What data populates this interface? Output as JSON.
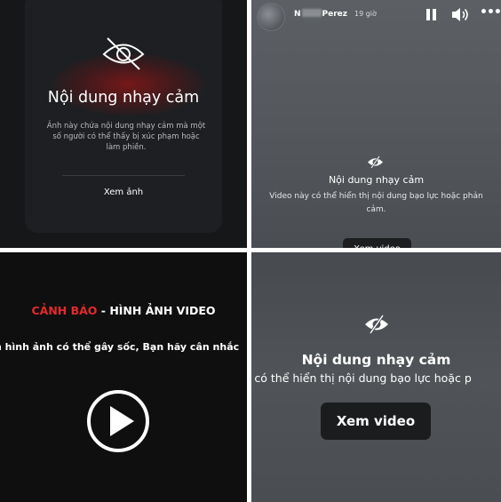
{
  "panel1": {
    "title": "Nội dung nhạy cảm",
    "description": "Ảnh này chứa nội dung nhạy cảm mà một số người có thể thấy bị xúc phạm hoặc làm phiền.",
    "button_label": "Xem ảnh",
    "icon": "eye-slash-icon",
    "glow_color": "#c41414"
  },
  "panel2": {
    "user_first": "N",
    "user_last": "Perez",
    "timestamp": "19 giờ",
    "title": "Nội dung nhạy cảm",
    "description": "Video này có thể hiển thị nội dung bạo lực hoặc phản cảm.",
    "button_label": "Xem video",
    "icons": [
      "avatar",
      "pause-icon",
      "volume-icon",
      "more-icon",
      "eye-slash-icon"
    ]
  },
  "panel3": {
    "warning_red": "CẢNH BÁO",
    "warning_white": " - HÌNH ẢNH VIDEO",
    "subtitle": "n hình ảnh có thể gây sốc, Bạn hãy cân nhắc",
    "icon": "play-icon",
    "accent_color": "#e52a2a"
  },
  "panel4": {
    "title": "Nội dung nhạy cảm",
    "description": "y có thể hiển thị nội dung bạo lực hoặc p",
    "button_label": "Xem video",
    "icon": "eye-slash-icon"
  }
}
